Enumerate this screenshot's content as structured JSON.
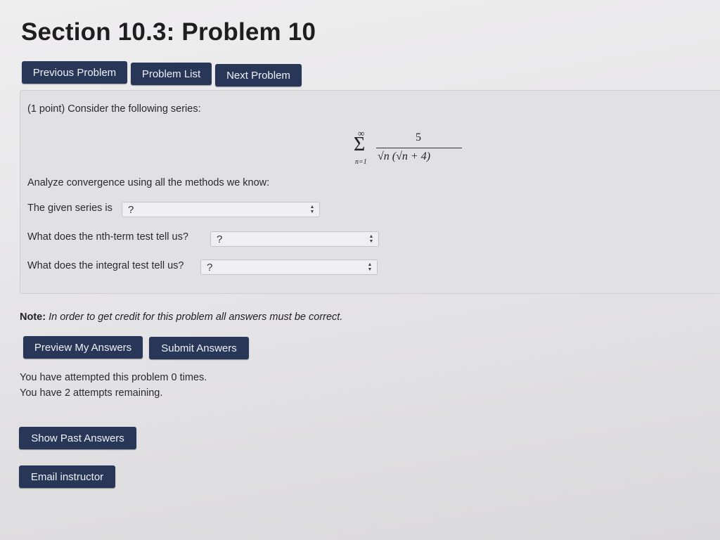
{
  "page": {
    "title": "Section 10.3: Problem 10"
  },
  "nav": {
    "previous": "Previous Problem",
    "list": "Problem List",
    "next": "Next Problem"
  },
  "problem": {
    "intro": "(1 point) Consider the following series:",
    "series": {
      "sigma": "Σ",
      "upper": "∞",
      "lower": "n=1",
      "numerator": "5",
      "denominator": "√n (√n + 4)"
    },
    "analyze": "Analyze convergence using all the methods we know:",
    "q1": {
      "label": "The given series is",
      "value": "?"
    },
    "q2": {
      "label": "What does the nth-term test tell us?",
      "value": "?"
    },
    "q3": {
      "label": "What does the integral test tell us?",
      "value": "?"
    }
  },
  "note": {
    "label": "Note:",
    "text": "In order to get credit for this problem all answers must be correct."
  },
  "actions": {
    "preview": "Preview My Answers",
    "submit": "Submit Answers"
  },
  "attempts": {
    "line1": "You have attempted this problem 0 times.",
    "line2": "You have 2 attempts remaining."
  },
  "extra": {
    "past": "Show Past Answers",
    "email": "Email instructor"
  }
}
